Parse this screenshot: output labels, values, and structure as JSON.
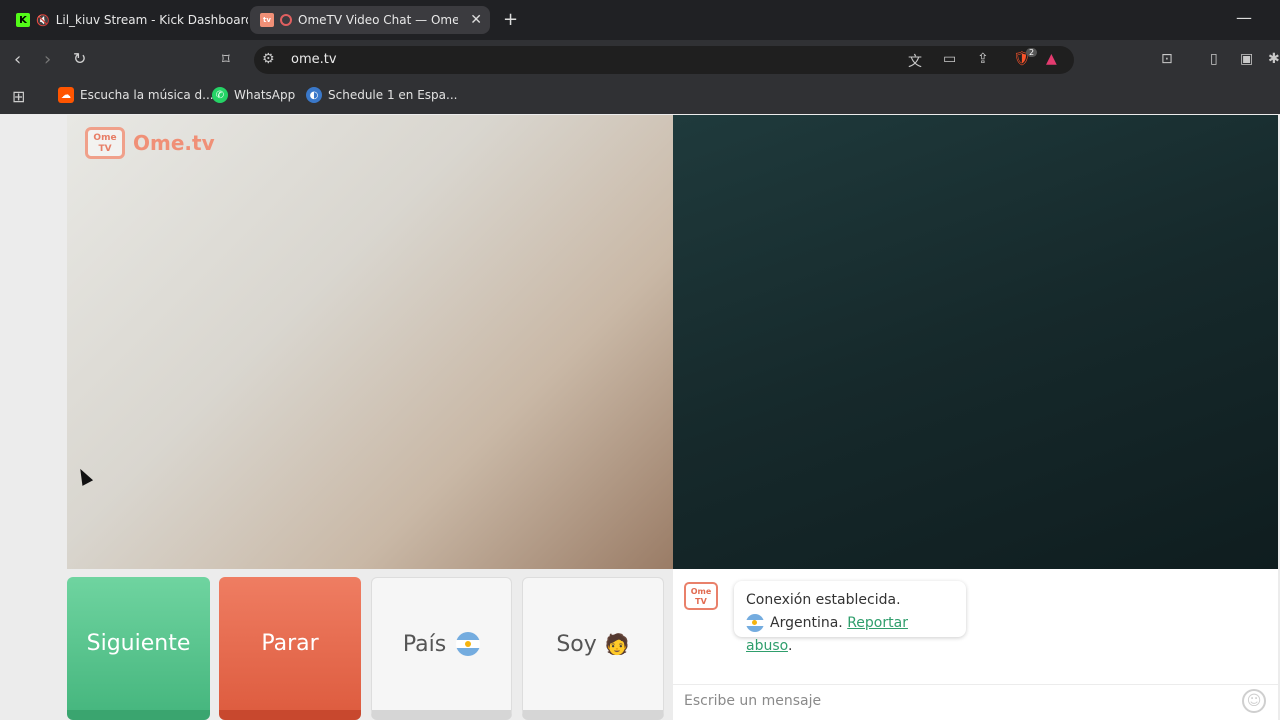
{
  "browser": {
    "tabs": [
      {
        "title": "Lil_kiuv Stream - Kick Dashboard",
        "favicon": "kick-logo"
      },
      {
        "title": "OmeTV Video Chat — Omegl",
        "favicon": "ometv-logo"
      }
    ],
    "url": "ome.tv",
    "bookmarks": [
      {
        "label": "Escucha la música d...",
        "icon": "soundcloud-icon"
      },
      {
        "label": "WhatsApp",
        "icon": "whatsapp-icon"
      },
      {
        "label": "Schedule 1 en Espa...",
        "icon": "schedule-icon"
      }
    ],
    "brave_badge": "2"
  },
  "app": {
    "logo_text": "Ome.tv",
    "logo_tv": "Ome\nTV",
    "buttons": {
      "next": "Siguiente",
      "stop": "Parar",
      "country": "País",
      "gender": "Soy"
    },
    "gender_emoji": "🧑",
    "chat": {
      "line1": "Conexión establecida.",
      "country": "Argentina.",
      "report": "Reportar abuso",
      "period": ".",
      "placeholder": "Escribe un mensaje"
    }
  }
}
